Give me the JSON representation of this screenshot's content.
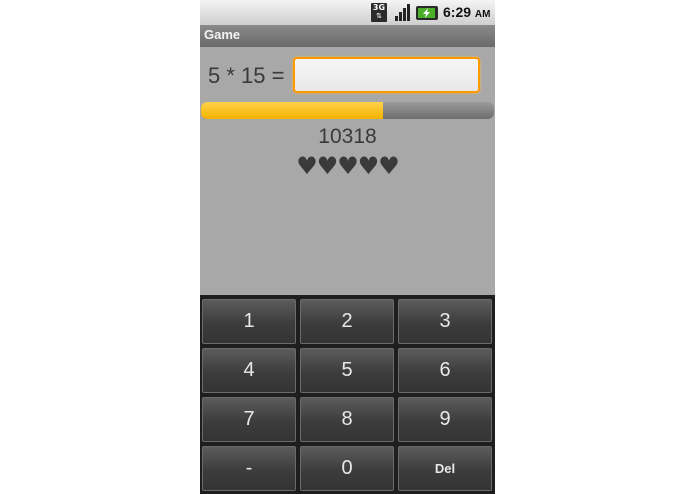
{
  "status_bar": {
    "network_badge": "3G",
    "time": "6:29",
    "ampm": "AM",
    "icons": [
      "3g-data-icon",
      "signal-icon",
      "battery-charging-icon"
    ]
  },
  "app": {
    "title": "Game"
  },
  "game": {
    "question": "5 * 15 =",
    "answer_value": "",
    "progress_percent": 62,
    "score": "10318",
    "lives": [
      "♥",
      "♥",
      "♥",
      "♥",
      "♥"
    ]
  },
  "keypad": {
    "keys": [
      "1",
      "2",
      "3",
      "4",
      "5",
      "6",
      "7",
      "8",
      "9",
      "-",
      "0",
      "Del"
    ]
  },
  "colors": {
    "accent": "#ff9900",
    "progress": "#f5b200",
    "background": "#a8a8a8"
  }
}
